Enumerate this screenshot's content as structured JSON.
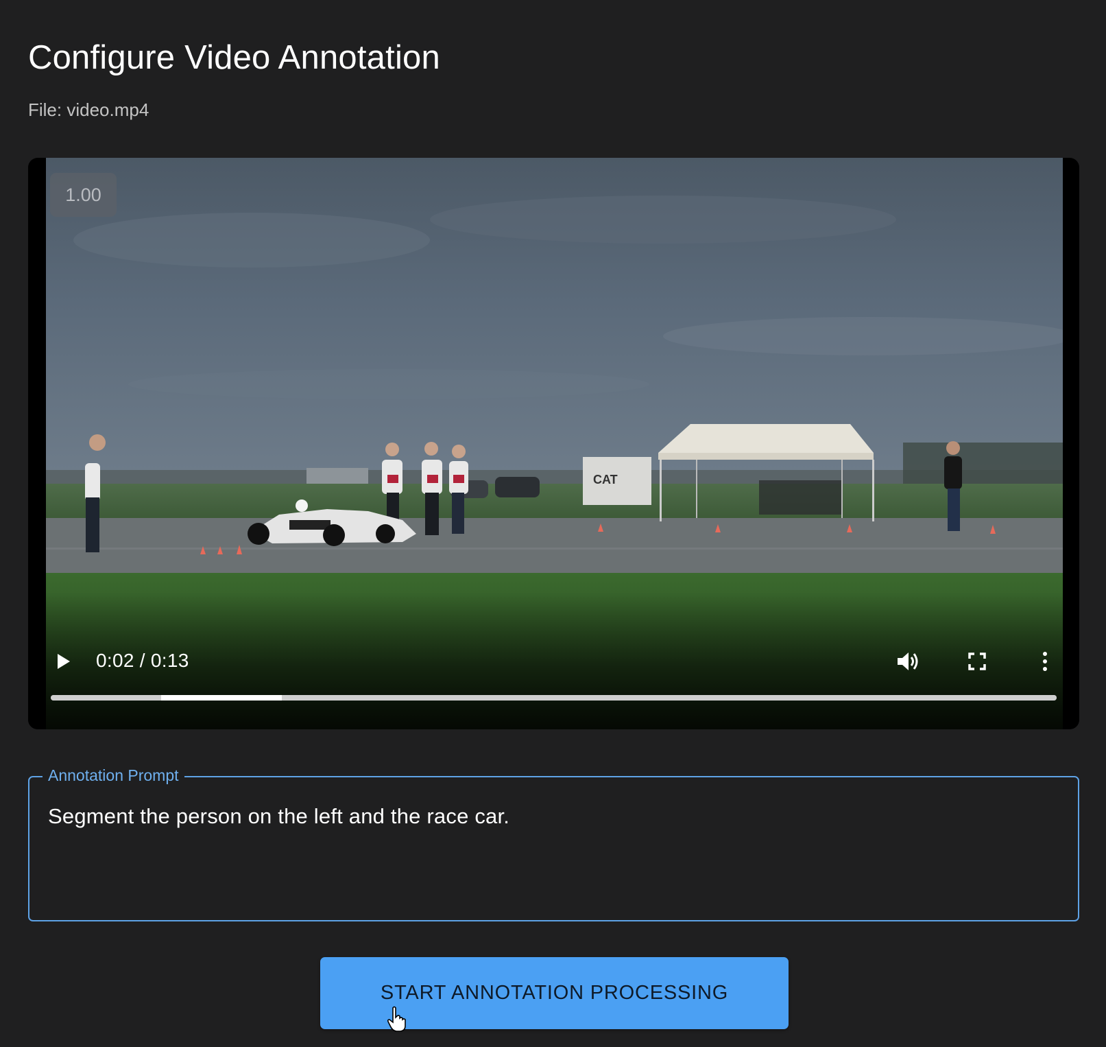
{
  "page": {
    "title": "Configure Video Annotation",
    "file_label": "File: video.mp4"
  },
  "player": {
    "speed": "1.00",
    "time": "0:02 / 0:13",
    "progress_played_fraction": 0.11,
    "progress_window_fraction": [
      0.11,
      0.23
    ],
    "icons": {
      "play": "play-icon",
      "volume": "volume-icon",
      "fullscreen": "fullscreen-icon",
      "more": "more-vertical-icon"
    }
  },
  "prompt": {
    "label": "Annotation Prompt",
    "value": "Segment the person on the left and the race car."
  },
  "actions": {
    "start_label": "START ANNOTATION PROCESSING"
  },
  "colors": {
    "background": "#1f1f20",
    "accent": "#4ba0f3",
    "prompt_border": "#5ea2e6"
  }
}
